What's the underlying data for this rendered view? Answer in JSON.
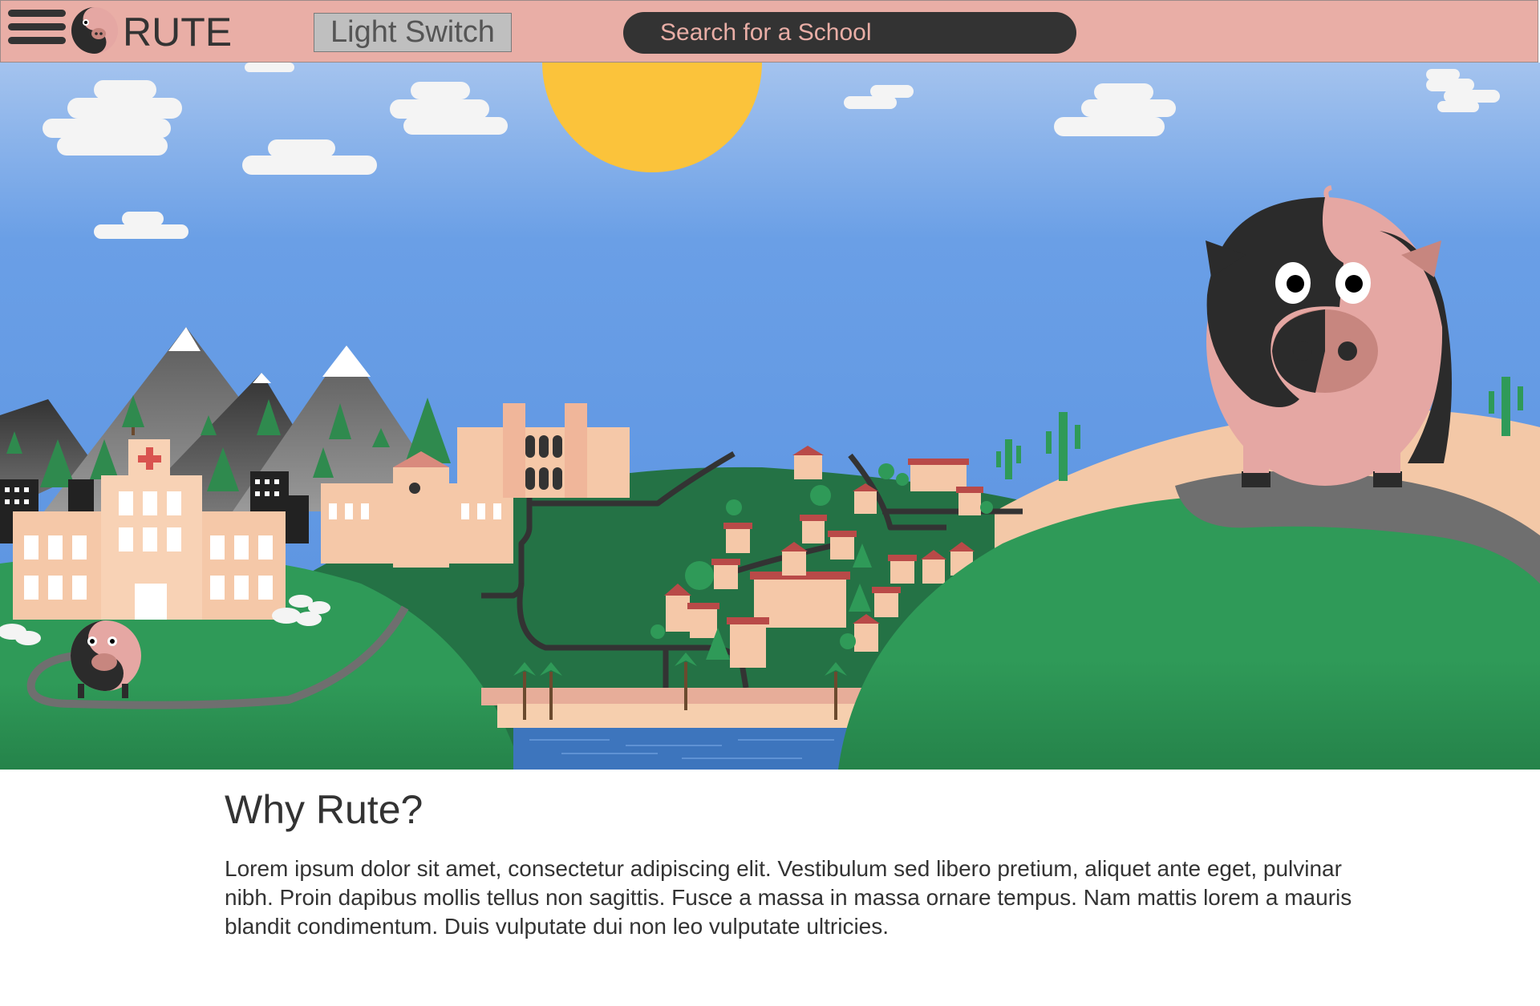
{
  "header": {
    "brand": "RUTE",
    "light_switch_label": "Light Switch",
    "search_placeholder": "Search for a School",
    "menu_icon": "hamburger-menu-icon",
    "logo_icon": "pig-logo-icon"
  },
  "colors": {
    "header_bg": "#e9aea6",
    "search_bg": "#333333",
    "sky_top": "#a4c3ee",
    "sky": "#5a96e3",
    "sun": "#fbc33b",
    "grass": "#2f9a58",
    "grass_dark": "#247245",
    "pig_pink": "#e5a7a3",
    "pig_black": "#2b2b2b"
  },
  "main": {
    "heading": "Why Rute?",
    "body": "Lorem ipsum dolor sit amet, consectetur adipiscing elit. Vestibulum sed libero pretium, aliquet ante eget, pulvinar nibh. Proin dapibus mollis tellus non sagittis. Fusce a massa in massa ornare tempus. Nam mattis lorem a mauris blandit condimentum. Duis vulputate dui non leo vulputate ultricies."
  }
}
